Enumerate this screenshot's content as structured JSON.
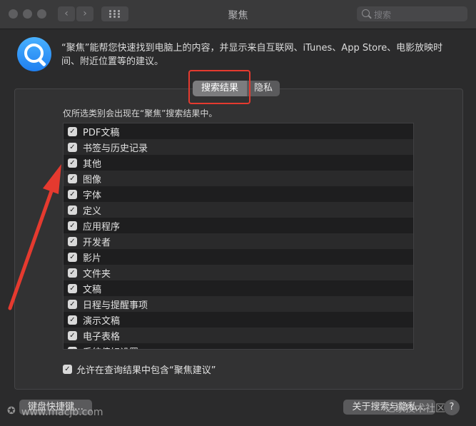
{
  "window": {
    "title": "聚焦"
  },
  "search": {
    "placeholder": "搜索"
  },
  "header": {
    "description": "“聚焦”能帮您快速找到电脑上的内容，并显示来自互联网、iTunes、App Store、电影放映时间、附近位置等的建议。"
  },
  "tabs": [
    {
      "label": "搜索结果",
      "active": true
    },
    {
      "label": "隐私",
      "active": false
    }
  ],
  "panel": {
    "caption": "仅所选类别会出现在“聚焦”搜索结果中。",
    "categories": [
      {
        "label": "PDF文稿",
        "checked": true
      },
      {
        "label": "书签与历史记录",
        "checked": true
      },
      {
        "label": "其他",
        "checked": true
      },
      {
        "label": "图像",
        "checked": true
      },
      {
        "label": "字体",
        "checked": true
      },
      {
        "label": "定义",
        "checked": true
      },
      {
        "label": "应用程序",
        "checked": true
      },
      {
        "label": "开发者",
        "checked": true
      },
      {
        "label": "影片",
        "checked": true
      },
      {
        "label": "文件夹",
        "checked": true
      },
      {
        "label": "文稿",
        "checked": true
      },
      {
        "label": "日程与提醒事项",
        "checked": true
      },
      {
        "label": "演示文稿",
        "checked": true
      },
      {
        "label": "电子表格",
        "checked": true
      },
      {
        "label": "系统偏好设置",
        "checked": true
      }
    ],
    "allow_suggestions": {
      "label": "允许在查询结果中包含“聚焦建议”",
      "checked": true
    }
  },
  "footer": {
    "shortcuts_button": "键盘快捷键…",
    "about_button": "关于搜索与隐私…",
    "help_label": "?"
  },
  "watermark": {
    "left": "www.macjb.com",
    "right": "之家技术社区"
  },
  "colors": {
    "accent": "#1f7ff0",
    "annotation": "#e53a2f"
  }
}
